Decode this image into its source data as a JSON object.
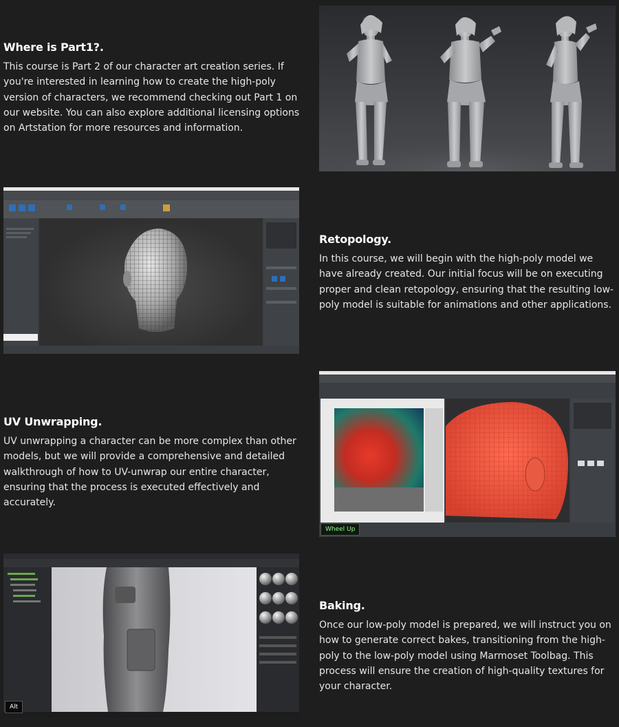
{
  "sections": [
    {
      "title": "Where is Part1?.",
      "text": "This course is Part 2 of our character art creation series. If you're interested in learning how to create the high-poly version of characters, we recommend checking out Part 1 on our website. You can also explore additional licensing options on Artstation for more resources and information."
    },
    {
      "title": "Retopology.",
      "text": "In this course, we will begin with the high-poly model we have already created. Our initial focus will be on executing proper and clean retopology, ensuring that the resulting low-poly model is suitable for animations and other applications."
    },
    {
      "title": "UV Unwrapping.",
      "text": "UV unwrapping a character can be more complex than other models, but we will provide a comprehensive and detailed walkthrough of how to UV-unwrap our entire character, ensuring that the process is executed effectively and accurately."
    },
    {
      "title": "Baking.",
      "text": "Once our low-poly model is prepared, we will instruct you on how to generate correct bakes, transitioning from the high-poly to the low-poly model using Marmoset Toolbag. This process will ensure the creation of high-quality textures for your character."
    }
  ],
  "overlays": {
    "uv_key": "Wheel Up",
    "bake_key": "Alt"
  },
  "colors": {
    "background": "#1e1e1e",
    "accent_blue": "#2e6fb6",
    "uv_red": "#e8503a"
  }
}
